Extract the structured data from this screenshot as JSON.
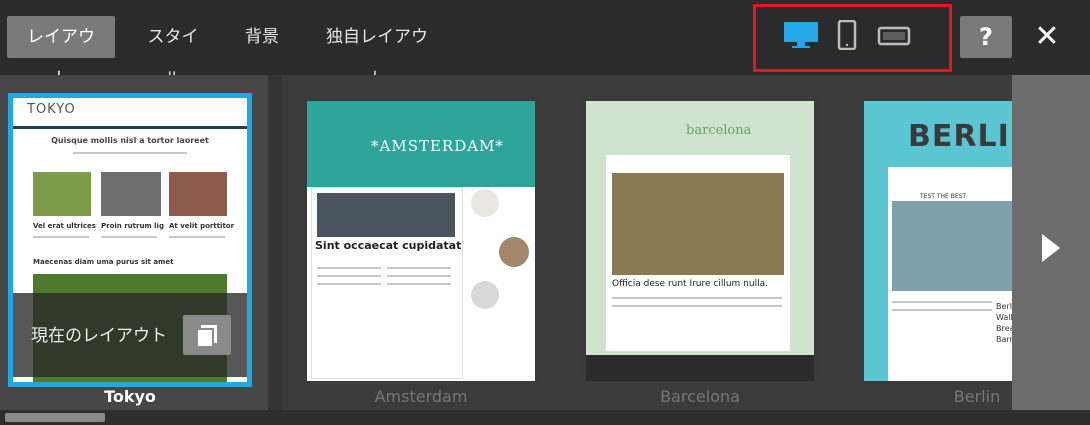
{
  "tabs": [
    {
      "label": "レイアウト",
      "active": true
    },
    {
      "label": "スタイル",
      "active": false
    },
    {
      "label": "背景",
      "active": false
    },
    {
      "label": "独自レイアウト",
      "active": false
    }
  ],
  "device_icons": [
    "desktop-icon",
    "phone-icon",
    "tablet-landscape-icon"
  ],
  "help_label": "?",
  "close_label": "✕",
  "accent_color": "#22a7e8",
  "highlight_color": "#e8141e",
  "current_layout_label": "現在のレイアウト",
  "templates": {
    "tokyo": {
      "name": "Tokyo",
      "logo": "TOKYO",
      "heading": "Quisque mollis nisl a tortor laoreet",
      "col1": "Vel erat ultrices",
      "col2": "Proin rutrum lig",
      "col3": "At velit porttitor",
      "section": "Maecenas diam uma purus sit amet"
    },
    "amsterdam": {
      "name": "Amsterdam",
      "logo": "*AMSTERDAM*",
      "heading": "Sint occaecat cupidatat"
    },
    "barcelona": {
      "name": "Barcelona",
      "logo": "barcelona",
      "heading": "Officia dese runt Irure cillum nulla."
    },
    "berlin": {
      "name": "Berlin",
      "logo": "BERLIN",
      "heading": "Berlin Wall Break Barriers",
      "tag": "TEST THE BEST"
    }
  }
}
